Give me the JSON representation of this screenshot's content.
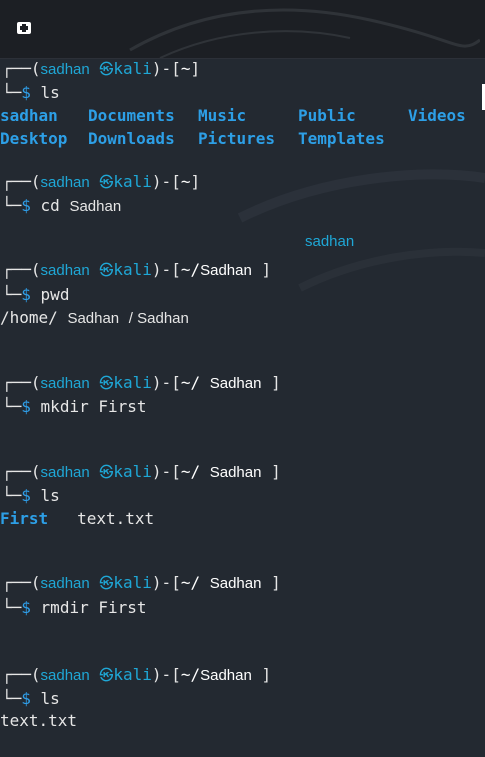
{
  "toolbar": {
    "new_tab_icon": "new-tab-icon"
  },
  "prompt": {
    "open": "┌──(",
    "user": "sadhan",
    "at": "㉿",
    "host": "kali",
    "close": ")-[",
    "bar": "└─",
    "dollar": "$"
  },
  "blocks": [
    {
      "path": "~",
      "command": "ls",
      "output_cols": [
        [
          "sadhan",
          "Desktop"
        ],
        [
          "Documents",
          "Downloads"
        ],
        [
          "Music",
          "Pictures"
        ],
        [
          "Public",
          "Templates"
        ],
        [
          "Videos",
          ""
        ]
      ]
    },
    {
      "path": "~",
      "command": "cd",
      "arg": "Sadhan",
      "floating": "sadhan"
    },
    {
      "path": "~/",
      "path_tail": "Sadhan",
      "command": "pwd",
      "output": "/home/",
      "output2": "Sadhan",
      "output3": "/ Sadhan"
    },
    {
      "path": "~/",
      "path_tail": "Sadhan",
      "command": "mkdir",
      "arg": "First"
    },
    {
      "path": "~/",
      "path_tail": "Sadhan",
      "command": "ls",
      "out_dir": "First",
      "out_file": "text.txt"
    },
    {
      "path": "~/",
      "path_tail": "Sadhan",
      "command": "rmdir",
      "arg": "First"
    },
    {
      "path": "~/",
      "path_tail": "Sadhan",
      "command": "ls",
      "out_file": "text.txt"
    }
  ],
  "close_bracket": "]"
}
